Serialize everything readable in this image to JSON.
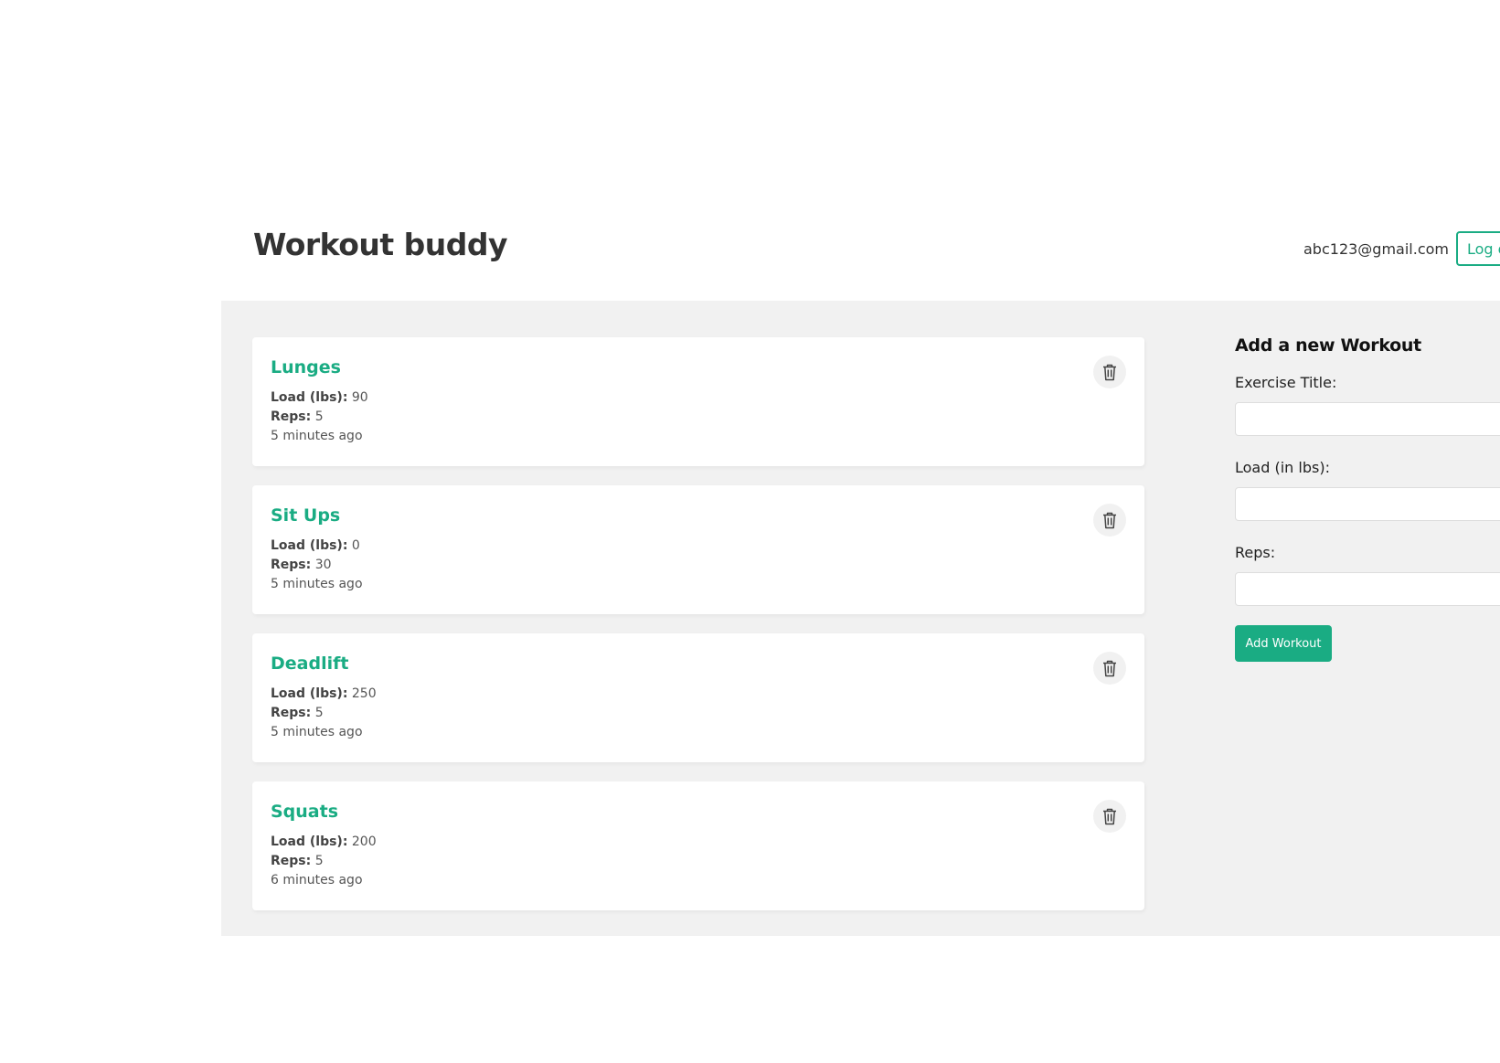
{
  "header": {
    "logo": "Workout buddy",
    "user_email": "abc123@gmail.com",
    "logout_label": "Log out"
  },
  "workouts": [
    {
      "title": "Lunges",
      "load_label": "Load (lbs):",
      "load": "90",
      "reps_label": "Reps:",
      "reps": "5",
      "time": "5 minutes ago"
    },
    {
      "title": "Sit Ups",
      "load_label": "Load (lbs):",
      "load": "0",
      "reps_label": "Reps:",
      "reps": "30",
      "time": "5 minutes ago"
    },
    {
      "title": "Deadlift",
      "load_label": "Load (lbs):",
      "load": "250",
      "reps_label": "Reps:",
      "reps": "5",
      "time": "5 minutes ago"
    },
    {
      "title": "Squats",
      "load_label": "Load (lbs):",
      "load": "200",
      "reps_label": "Reps:",
      "reps": "5",
      "time": "6 minutes ago"
    }
  ],
  "form": {
    "title": "Add a new Workout",
    "exercise_title_label": "Exercise Title:",
    "exercise_title_value": "",
    "load_label": "Load (in lbs):",
    "load_value": "",
    "reps_label": "Reps:",
    "reps_value": "",
    "submit_label": "Add Workout"
  },
  "icons": {
    "delete": "trash-icon"
  },
  "colors": {
    "accent": "#1aac83",
    "background": "#f1f1f1",
    "card": "#ffffff"
  }
}
